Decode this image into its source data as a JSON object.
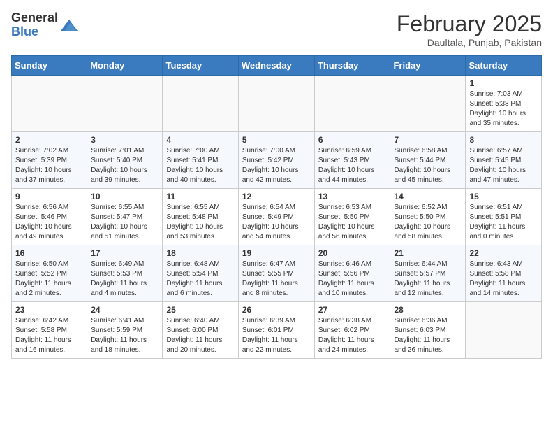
{
  "logo": {
    "general": "General",
    "blue": "Blue"
  },
  "title": "February 2025",
  "subtitle": "Daultala, Punjab, Pakistan",
  "weekdays": [
    "Sunday",
    "Monday",
    "Tuesday",
    "Wednesday",
    "Thursday",
    "Friday",
    "Saturday"
  ],
  "weeks": [
    [
      {
        "day": "",
        "info": ""
      },
      {
        "day": "",
        "info": ""
      },
      {
        "day": "",
        "info": ""
      },
      {
        "day": "",
        "info": ""
      },
      {
        "day": "",
        "info": ""
      },
      {
        "day": "",
        "info": ""
      },
      {
        "day": "1",
        "info": "Sunrise: 7:03 AM\nSunset: 5:38 PM\nDaylight: 10 hours\nand 35 minutes."
      }
    ],
    [
      {
        "day": "2",
        "info": "Sunrise: 7:02 AM\nSunset: 5:39 PM\nDaylight: 10 hours\nand 37 minutes."
      },
      {
        "day": "3",
        "info": "Sunrise: 7:01 AM\nSunset: 5:40 PM\nDaylight: 10 hours\nand 39 minutes."
      },
      {
        "day": "4",
        "info": "Sunrise: 7:00 AM\nSunset: 5:41 PM\nDaylight: 10 hours\nand 40 minutes."
      },
      {
        "day": "5",
        "info": "Sunrise: 7:00 AM\nSunset: 5:42 PM\nDaylight: 10 hours\nand 42 minutes."
      },
      {
        "day": "6",
        "info": "Sunrise: 6:59 AM\nSunset: 5:43 PM\nDaylight: 10 hours\nand 44 minutes."
      },
      {
        "day": "7",
        "info": "Sunrise: 6:58 AM\nSunset: 5:44 PM\nDaylight: 10 hours\nand 45 minutes."
      },
      {
        "day": "8",
        "info": "Sunrise: 6:57 AM\nSunset: 5:45 PM\nDaylight: 10 hours\nand 47 minutes."
      }
    ],
    [
      {
        "day": "9",
        "info": "Sunrise: 6:56 AM\nSunset: 5:46 PM\nDaylight: 10 hours\nand 49 minutes."
      },
      {
        "day": "10",
        "info": "Sunrise: 6:55 AM\nSunset: 5:47 PM\nDaylight: 10 hours\nand 51 minutes."
      },
      {
        "day": "11",
        "info": "Sunrise: 6:55 AM\nSunset: 5:48 PM\nDaylight: 10 hours\nand 53 minutes."
      },
      {
        "day": "12",
        "info": "Sunrise: 6:54 AM\nSunset: 5:49 PM\nDaylight: 10 hours\nand 54 minutes."
      },
      {
        "day": "13",
        "info": "Sunrise: 6:53 AM\nSunset: 5:50 PM\nDaylight: 10 hours\nand 56 minutes."
      },
      {
        "day": "14",
        "info": "Sunrise: 6:52 AM\nSunset: 5:50 PM\nDaylight: 10 hours\nand 58 minutes."
      },
      {
        "day": "15",
        "info": "Sunrise: 6:51 AM\nSunset: 5:51 PM\nDaylight: 11 hours\nand 0 minutes."
      }
    ],
    [
      {
        "day": "16",
        "info": "Sunrise: 6:50 AM\nSunset: 5:52 PM\nDaylight: 11 hours\nand 2 minutes."
      },
      {
        "day": "17",
        "info": "Sunrise: 6:49 AM\nSunset: 5:53 PM\nDaylight: 11 hours\nand 4 minutes."
      },
      {
        "day": "18",
        "info": "Sunrise: 6:48 AM\nSunset: 5:54 PM\nDaylight: 11 hours\nand 6 minutes."
      },
      {
        "day": "19",
        "info": "Sunrise: 6:47 AM\nSunset: 5:55 PM\nDaylight: 11 hours\nand 8 minutes."
      },
      {
        "day": "20",
        "info": "Sunrise: 6:46 AM\nSunset: 5:56 PM\nDaylight: 11 hours\nand 10 minutes."
      },
      {
        "day": "21",
        "info": "Sunrise: 6:44 AM\nSunset: 5:57 PM\nDaylight: 11 hours\nand 12 minutes."
      },
      {
        "day": "22",
        "info": "Sunrise: 6:43 AM\nSunset: 5:58 PM\nDaylight: 11 hours\nand 14 minutes."
      }
    ],
    [
      {
        "day": "23",
        "info": "Sunrise: 6:42 AM\nSunset: 5:58 PM\nDaylight: 11 hours\nand 16 minutes."
      },
      {
        "day": "24",
        "info": "Sunrise: 6:41 AM\nSunset: 5:59 PM\nDaylight: 11 hours\nand 18 minutes."
      },
      {
        "day": "25",
        "info": "Sunrise: 6:40 AM\nSunset: 6:00 PM\nDaylight: 11 hours\nand 20 minutes."
      },
      {
        "day": "26",
        "info": "Sunrise: 6:39 AM\nSunset: 6:01 PM\nDaylight: 11 hours\nand 22 minutes."
      },
      {
        "day": "27",
        "info": "Sunrise: 6:38 AM\nSunset: 6:02 PM\nDaylight: 11 hours\nand 24 minutes."
      },
      {
        "day": "28",
        "info": "Sunrise: 6:36 AM\nSunset: 6:03 PM\nDaylight: 11 hours\nand 26 minutes."
      },
      {
        "day": "",
        "info": ""
      }
    ]
  ]
}
